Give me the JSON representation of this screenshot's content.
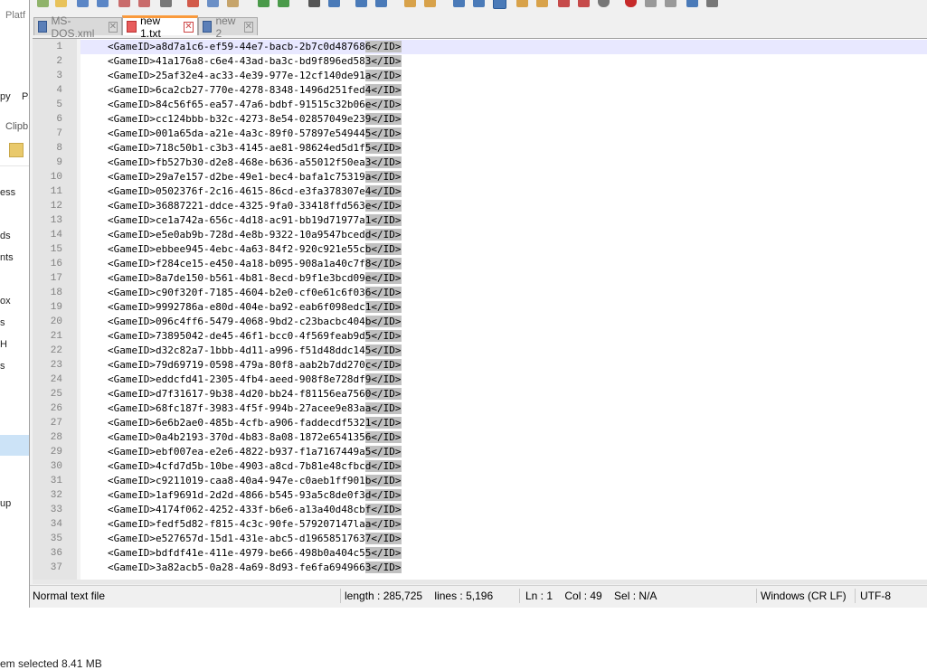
{
  "explorer": {
    "fragments": [
      "Platf",
      "py",
      "Pa",
      "Clipb",
      "ess",
      "ds",
      "nts",
      "ox",
      "s",
      "H",
      "s",
      "up"
    ],
    "status": "em selected  8.41 MB"
  },
  "tabs": [
    {
      "label": "MS-DOS.xml",
      "icon": "xml-file-icon"
    },
    {
      "label": "new 1.txt",
      "icon": "modified-file-icon",
      "active": true
    },
    {
      "label": "new 2",
      "icon": "file-icon"
    }
  ],
  "editor": {
    "lines": [
      {
        "num": "1",
        "text": "<GameID>a8d7a1c6-ef59-44e7-bacb-2b7c0d487686</ID>"
      },
      {
        "num": "2",
        "text": "<GameID>41a176a8-c6e4-43ad-ba3c-bd9f896ed583</ID>"
      },
      {
        "num": "3",
        "text": "<GameID>25af32e4-ac33-4e39-977e-12cf140de91a</ID>"
      },
      {
        "num": "4",
        "text": "<GameID>6ca2cb27-770e-4278-8348-1496d251fed4</ID>"
      },
      {
        "num": "5",
        "text": "<GameID>84c56f65-ea57-47a6-bdbf-91515c32b06e</ID>"
      },
      {
        "num": "6",
        "text": "<GameID>cc124bbb-b32c-4273-8e54-02857049e239</ID>"
      },
      {
        "num": "7",
        "text": "<GameID>001a65da-a21e-4a3c-89f0-57897e549445</ID>"
      },
      {
        "num": "8",
        "text": "<GameID>718c50b1-c3b3-4145-ae81-98624ed5d1f5</ID>"
      },
      {
        "num": "9",
        "text": "<GameID>fb527b30-d2e8-468e-b636-a55012f50ea3</ID>"
      },
      {
        "num": "10",
        "text": "<GameID>29a7e157-d2be-49e1-bec4-bafa1c75319a</ID>"
      },
      {
        "num": "11",
        "text": "<GameID>0502376f-2c16-4615-86cd-e3fa378307e4</ID>"
      },
      {
        "num": "12",
        "text": "<GameID>36887221-ddce-4325-9fa0-33418ffd563e</ID>"
      },
      {
        "num": "13",
        "text": "<GameID>ce1a742a-656c-4d18-ac91-bb19d71977a1</ID>"
      },
      {
        "num": "14",
        "text": "<GameID>e5e0ab9b-728d-4e8b-9322-10a9547bcedd</ID>"
      },
      {
        "num": "15",
        "text": "<GameID>ebbee945-4ebc-4a63-84f2-920c921e55cb</ID>"
      },
      {
        "num": "16",
        "text": "<GameID>f284ce15-e450-4a18-b095-908a1a40c7f8</ID>"
      },
      {
        "num": "17",
        "text": "<GameID>8a7de150-b561-4b81-8ecd-b9f1e3bcd09e</ID>"
      },
      {
        "num": "18",
        "text": "<GameID>c90f320f-7185-4604-b2e0-cf0e61c6f036</ID>"
      },
      {
        "num": "19",
        "text": "<GameID>9992786a-e80d-404e-ba92-eab6f098edc1</ID>"
      },
      {
        "num": "20",
        "text": "<GameID>096c4ff6-5479-4068-9bd2-c23bacbc404b</ID>"
      },
      {
        "num": "21",
        "text": "<GameID>73895042-de45-46f1-bcc0-4f569feab9d5</ID>"
      },
      {
        "num": "22",
        "text": "<GameID>d32c82a7-1bbb-4d11-a996-f51d48ddc145</ID>"
      },
      {
        "num": "23",
        "text": "<GameID>79d69719-0598-479a-80f8-aab2b7dd270c</ID>"
      },
      {
        "num": "24",
        "text": "<GameID>eddcfd41-2305-4fb4-aeed-908f8e728df9</ID>"
      },
      {
        "num": "25",
        "text": "<GameID>d7f31617-9b38-4d20-bb24-f81156ea7560</ID>"
      },
      {
        "num": "26",
        "text": "<GameID>68fc187f-3983-4f5f-994b-27acee9e83aa</ID>"
      },
      {
        "num": "27",
        "text": "<GameID>6e6b2ae0-485b-4cfb-a906-faddecdf5321</ID>"
      },
      {
        "num": "28",
        "text": "<GameID>0a4b2193-370d-4b83-8a08-1872e6541356</ID>"
      },
      {
        "num": "29",
        "text": "<GameID>ebf007ea-e2e6-4822-b937-f1a7167449a5</ID>"
      },
      {
        "num": "30",
        "text": "<GameID>4cfd7d5b-10be-4903-a8cd-7b81e48cfbcd</ID>"
      },
      {
        "num": "31",
        "text": "<GameID>c9211019-caa8-40a4-947e-c0aeb1ff901b</ID>"
      },
      {
        "num": "32",
        "text": "<GameID>1af9691d-2d2d-4866-b545-93a5c8de0f3d</ID>"
      },
      {
        "num": "33",
        "text": "<GameID>4174f062-4252-433f-b6e6-a13a40d48cbf</ID>"
      },
      {
        "num": "34",
        "text": "<GameID>fedf5d82-f815-4c3c-90fe-579207147laa</ID>"
      },
      {
        "num": "35",
        "text": "<GameID>e527657d-15d1-431e-abc5-d19658517637</ID>"
      },
      {
        "num": "36",
        "text": "<GameID>bdfdf41e-411e-4979-be66-498b0a404c55</ID>"
      },
      {
        "num": "37",
        "text": "<GameID>3a82acb5-0a28-4a69-8d93-fe6fa6949663</ID>"
      }
    ]
  },
  "statusbar": {
    "file_type": "Normal text file",
    "length_lines": "length : 285,725    lines : 5,196",
    "position": "Ln : 1    Col : 49    Sel : N/A",
    "line_endings": "Windows (CR LF)",
    "encoding": "UTF-8"
  },
  "colors": {
    "active_tab_accent": "#fa9a3c",
    "current_line": "#e8e8ff",
    "selection_highlight": "#c0c0c0"
  }
}
